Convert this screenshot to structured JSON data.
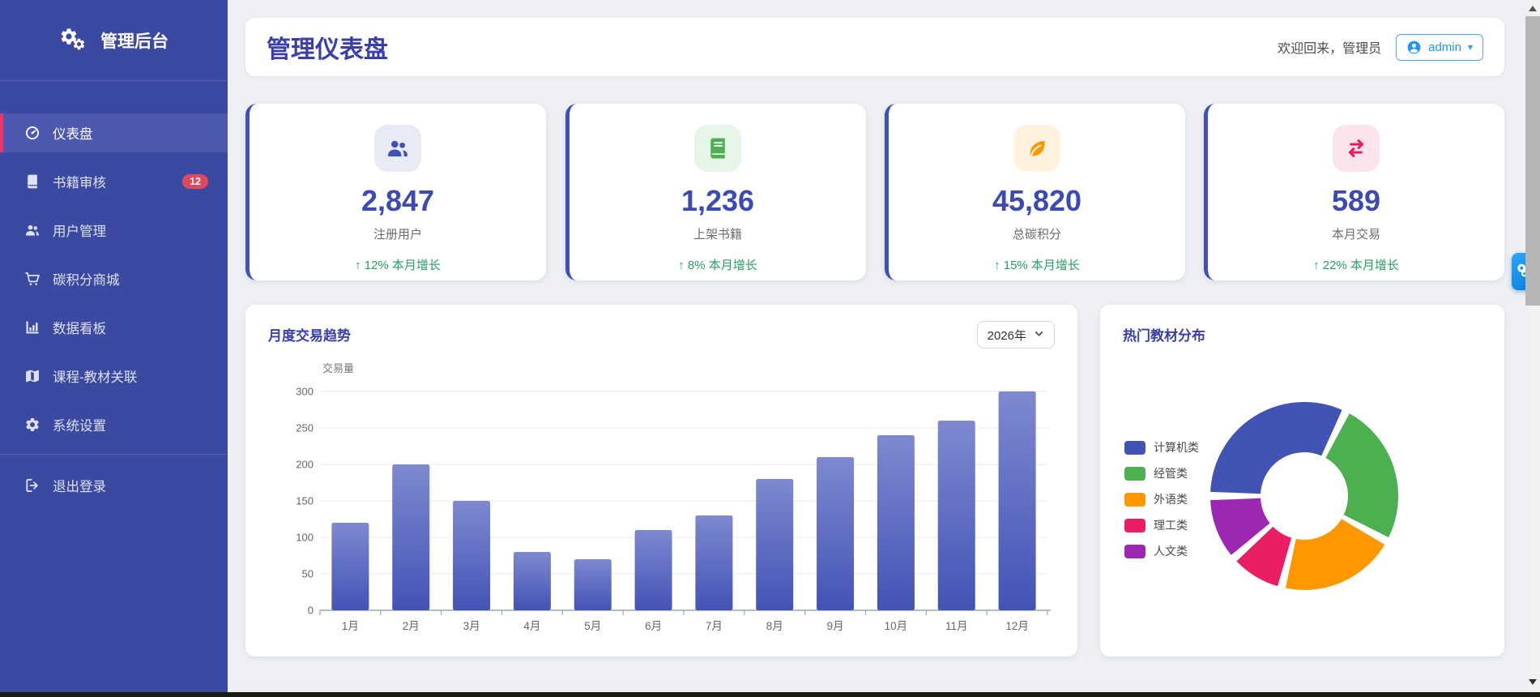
{
  "app": {
    "logo_title": "管理后台"
  },
  "sidebar": {
    "items": [
      {
        "name": "dashboard",
        "label": "仪表盘",
        "icon": "gauge-icon",
        "active": true
      },
      {
        "name": "book-review",
        "label": "书籍审核",
        "icon": "book-icon",
        "badge": "12"
      },
      {
        "name": "user-management",
        "label": "用户管理",
        "icon": "users-icon"
      },
      {
        "name": "points-mall",
        "label": "碳积分商城",
        "icon": "cart-icon"
      },
      {
        "name": "data-board",
        "label": "数据看板",
        "icon": "chart-icon"
      },
      {
        "name": "course-textbook",
        "label": "课程-教材关联",
        "icon": "map-icon"
      },
      {
        "name": "settings",
        "label": "系统设置",
        "icon": "gear-icon"
      }
    ],
    "logout": {
      "name": "logout",
      "label": "退出登录",
      "icon": "logout-icon"
    }
  },
  "header": {
    "title": "管理仪表盘",
    "welcome": "欢迎回来，管理员",
    "user_button": {
      "label": "admin",
      "icon": "user-avatar-icon",
      "caret": "▾"
    }
  },
  "stats": {
    "cards": [
      {
        "name": "registered-users",
        "icon": "users-group-icon",
        "icon_color": "#3f51b5",
        "icon_bg": "#e8eaf6",
        "value": "2,847",
        "label": "注册用户",
        "trend": "↑ 12% 本月增长"
      },
      {
        "name": "listed-books",
        "icon": "book-green-icon",
        "icon_color": "#4caf50",
        "icon_bg": "#e8f5e9",
        "value": "1,236",
        "label": "上架书籍",
        "trend": "↑ 8% 本月增长"
      },
      {
        "name": "carbon-points",
        "icon": "leaf-icon",
        "icon_color": "#ff9800",
        "icon_bg": "#fff3e0",
        "value": "45,820",
        "label": "总碳积分",
        "trend": "↑ 15% 本月增长"
      },
      {
        "name": "monthly-transactions",
        "icon": "swap-icon",
        "icon_color": "#e91e63",
        "icon_bg": "#fce4ec",
        "value": "589",
        "label": "本月交易",
        "trend": "↑ 22% 本月增长"
      }
    ],
    "trend_color": "#27a065"
  },
  "chart_data": [
    {
      "type": "bar",
      "title": "月度交易趋势",
      "year_label": "2026年",
      "ylabel": "交易量",
      "categories": [
        "1月",
        "2月",
        "3月",
        "4月",
        "5月",
        "6月",
        "7月",
        "8月",
        "9月",
        "10月",
        "11月",
        "12月"
      ],
      "values": [
        120,
        200,
        150,
        80,
        70,
        110,
        130,
        180,
        210,
        240,
        260,
        300
      ],
      "ylim": [
        0,
        300
      ],
      "yticks": [
        0,
        50,
        100,
        150,
        200,
        250,
        300
      ],
      "grid": true,
      "bar_gradient_top": "#7e89d0",
      "bar_gradient_bottom": "#4353b5"
    },
    {
      "type": "pie",
      "title": "热门教材分布",
      "legend_position": "left",
      "labels": [
        "计算机类",
        "经管类",
        "外语类",
        "理工类",
        "人文类"
      ],
      "values": [
        33,
        26,
        21,
        9,
        11
      ],
      "colors": [
        "#4154b3",
        "#4caf50",
        "#ff9800",
        "#e91e63",
        "#9c27b0"
      ],
      "inner_radius_ratio": 0.45
    }
  ]
}
